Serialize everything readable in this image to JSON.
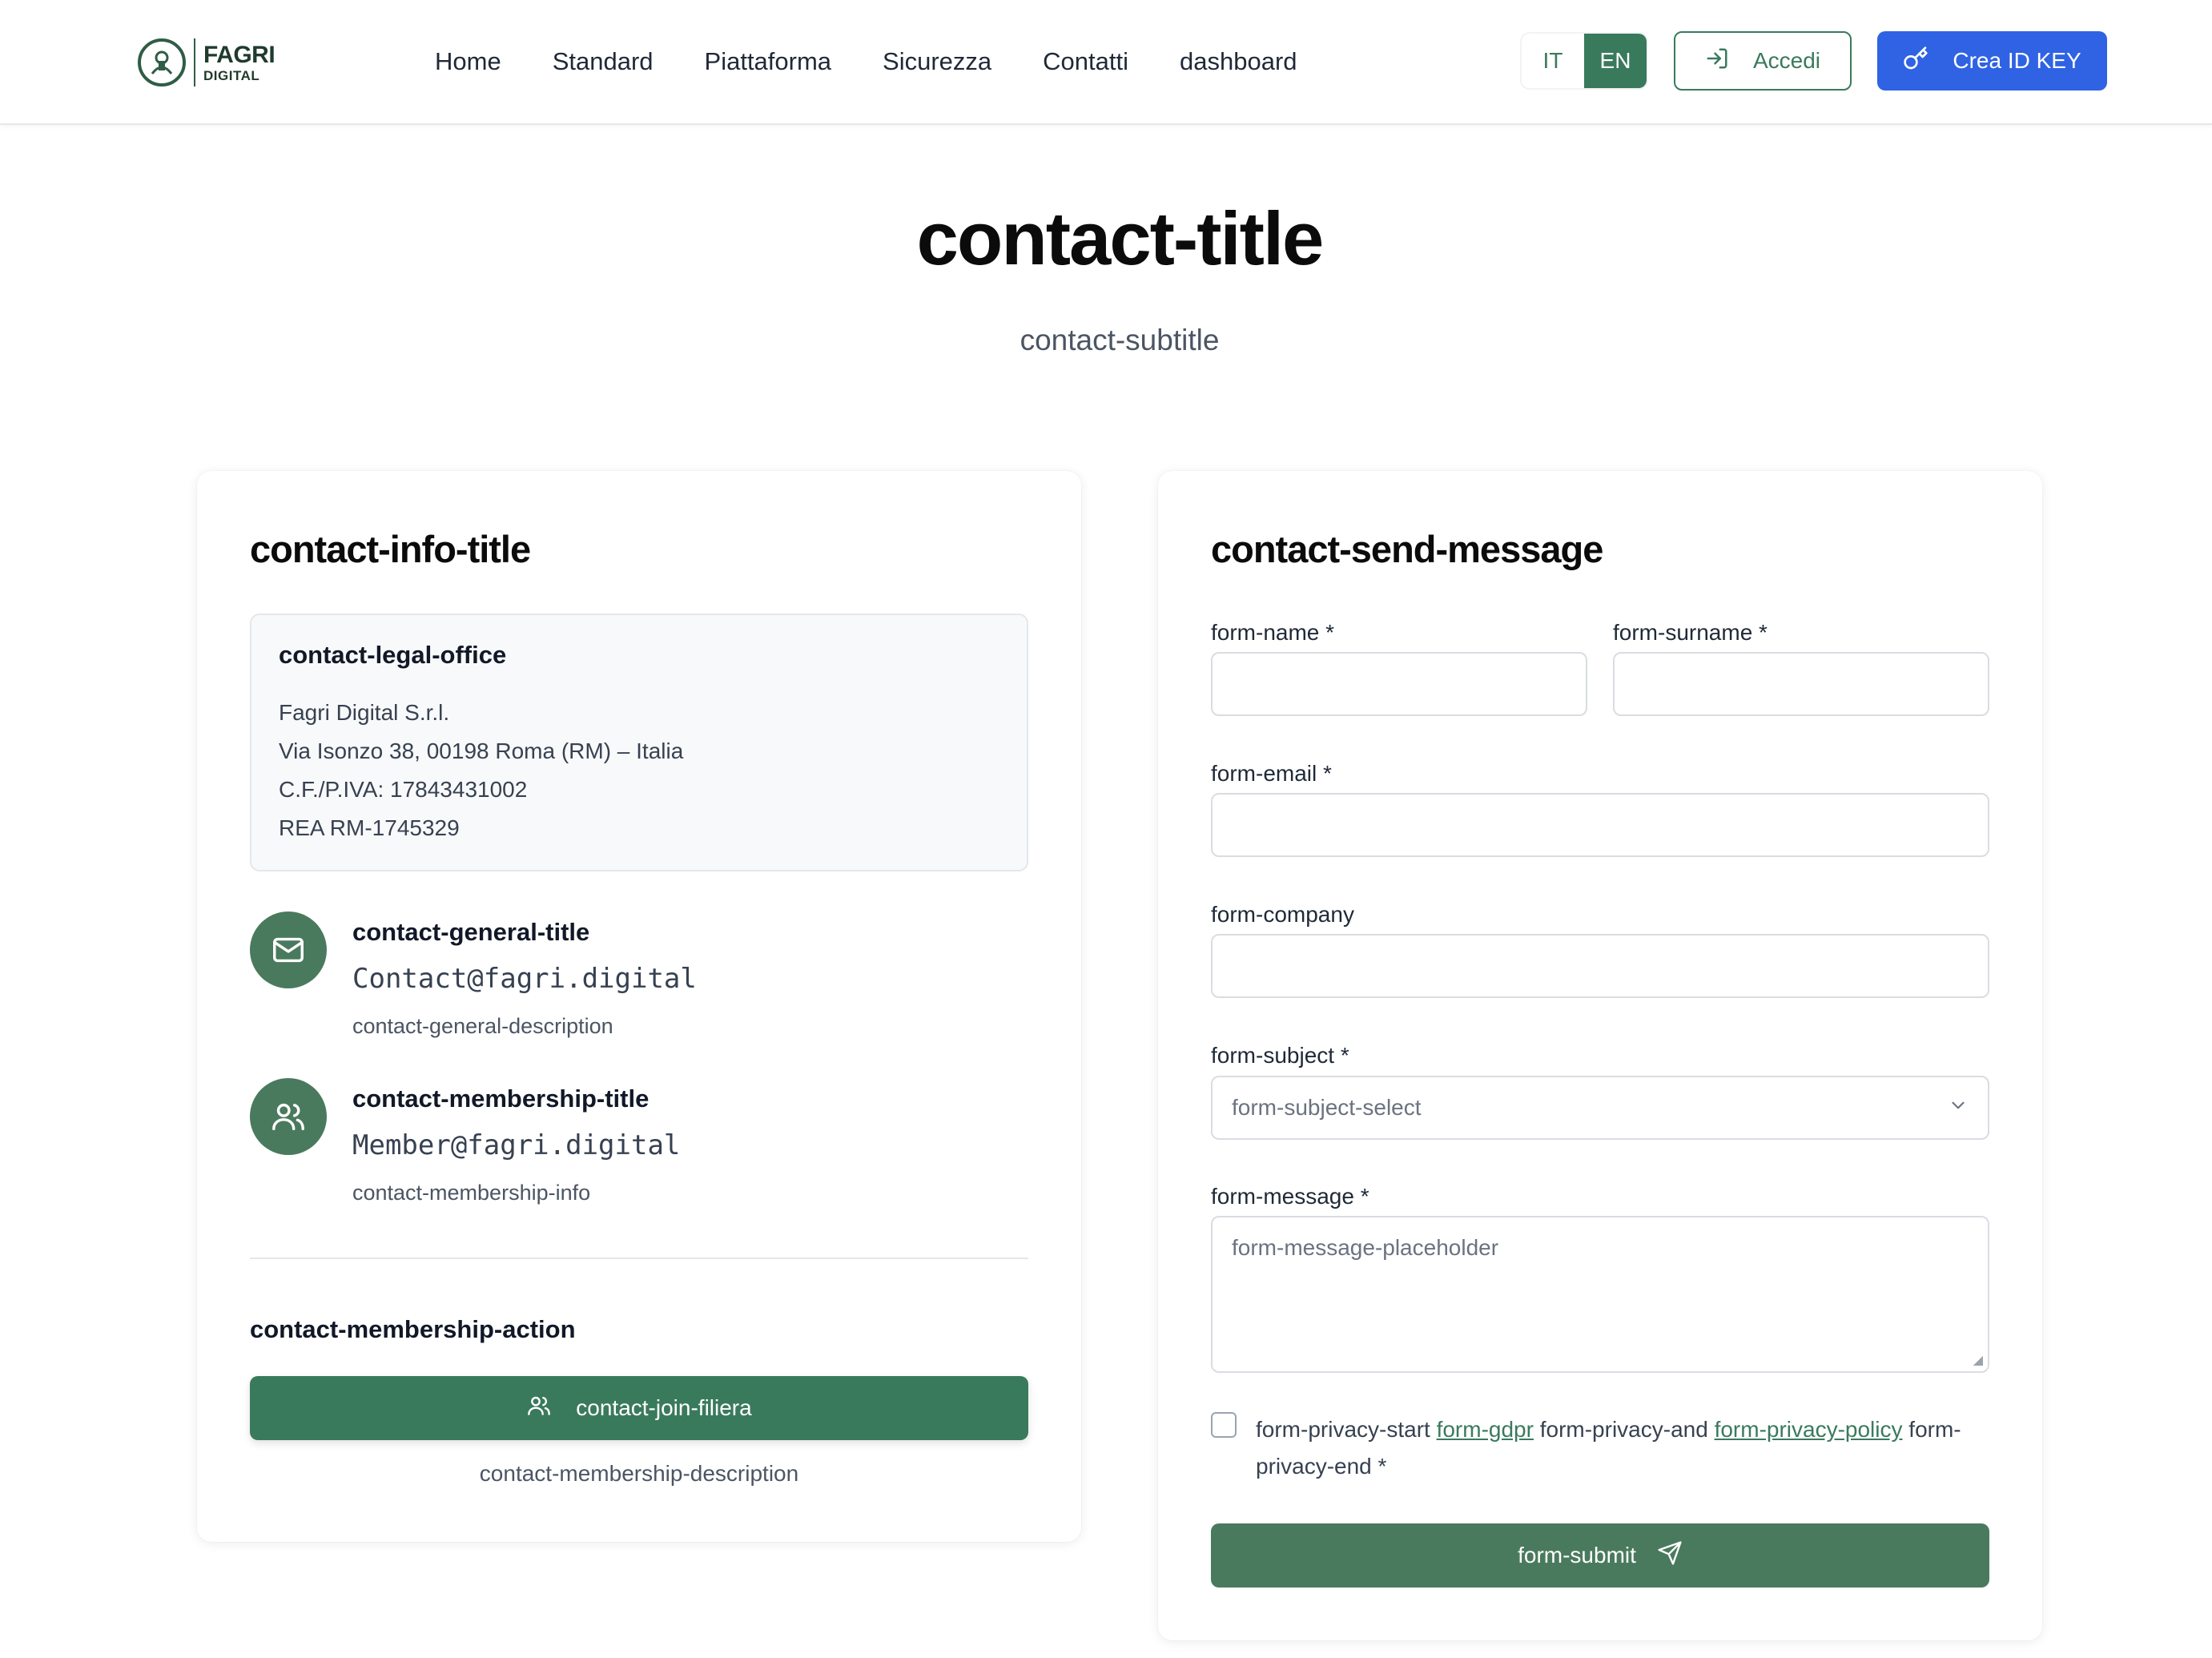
{
  "brand": {
    "logo_line1": "FAGRI",
    "logo_line2": "DIGITAL",
    "accent_color": "#3a7a5c",
    "primary_blue": "#2f63e3"
  },
  "nav": {
    "items": [
      {
        "label": "Home"
      },
      {
        "label": "Standard"
      },
      {
        "label": "Piattaforma"
      },
      {
        "label": "Sicurezza"
      },
      {
        "label": "Contatti"
      },
      {
        "label": "dashboard"
      }
    ]
  },
  "header": {
    "lang_it": "IT",
    "lang_en": "EN",
    "active_lang": "EN",
    "login_label": "Accedi",
    "login_icon": "log-in-icon",
    "create_key_label": "Crea ID KEY",
    "create_key_icon": "key-icon"
  },
  "hero": {
    "title": "contact-title",
    "subtitle": "contact-subtitle"
  },
  "info": {
    "title": "contact-info-title",
    "legal_office": {
      "title": "contact-legal-office",
      "company": "Fagri Digital S.r.l.",
      "address": "Via Isonzo 38, 00198 Roma (RM) – Italia",
      "vat": "C.F./P.IVA: 17843431002",
      "rea": "REA RM-1745329"
    },
    "general": {
      "icon": "mail-icon",
      "title": "contact-general-title",
      "email": "Contact@fagri.digital",
      "description": "contact-general-description"
    },
    "membership": {
      "icon": "users-icon",
      "title": "contact-membership-title",
      "email": "Member@fagri.digital",
      "info": "contact-membership-info"
    },
    "membership_action": "contact-membership-action",
    "join_button": "contact-join-filiera",
    "membership_description": "contact-membership-description"
  },
  "form": {
    "title": "contact-send-message",
    "name_label": "form-name *",
    "name_value": "",
    "surname_label": "form-surname *",
    "surname_value": "",
    "email_label": "form-email *",
    "email_value": "",
    "company_label": "form-company",
    "company_value": "",
    "subject_label": "form-subject *",
    "subject_selected": "form-subject-select",
    "message_label": "form-message *",
    "message_placeholder": "form-message-placeholder",
    "privacy_start": "form-privacy-start",
    "privacy_gdpr": "form-gdpr",
    "privacy_and": "form-privacy-and",
    "privacy_policy": "form-privacy-policy",
    "privacy_end": "form-privacy-end *",
    "privacy_checked": false,
    "submit_label": "form-submit",
    "submit_icon": "send-icon"
  }
}
